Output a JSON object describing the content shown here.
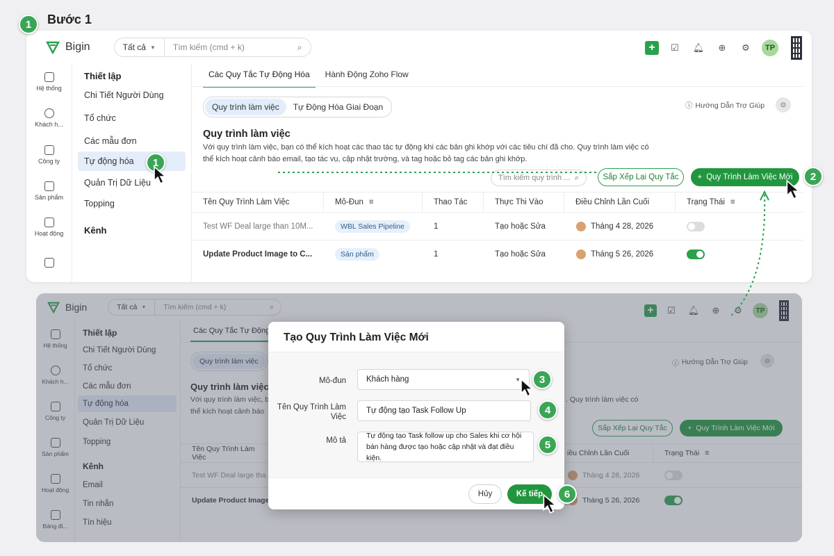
{
  "step_title": "Bước 1",
  "app_name": "Bigin",
  "search": {
    "scope": "Tất cả",
    "placeholder": "Tìm kiếm (cmd + k)"
  },
  "avatar": "TP",
  "left_nav": [
    "Hệ thống",
    "Khách h...",
    "Công ty",
    "Sản phẩm",
    "Hoạt động",
    ""
  ],
  "left_nav_back": [
    "Hệ thống",
    "Khách h...",
    "Công ty",
    "Sản phẩm",
    "Hoạt động",
    "Bảng đi..."
  ],
  "setup": {
    "heading": "Thiết lập",
    "items": [
      "Chi Tiết Người Dùng",
      "Tổ chức",
      "Các mẫu đơn",
      "Tự động hóa",
      "Quản Trị Dữ Liệu",
      "Topping"
    ],
    "channel_heading": "Kênh",
    "channel_items": [
      "Email",
      "Tin nhắn",
      "Tín hiệu"
    ]
  },
  "tabs": [
    "Các Quy Tắc Tự Động Hóa",
    "Hành Động Zoho Flow"
  ],
  "tab_back_truncated": "Các Quy Tắc Tự Động",
  "segments": [
    "Quy trình làm việc",
    "Tự Động Hóa Giai Đoạn"
  ],
  "help_link": "Hướng Dẫn Trợ Giúp",
  "section_title": "Quy trình làm việc",
  "section_title_back": "Quy trình làm việc",
  "description_line1": "Với quy trình làm việc, bạn có thể kích hoạt các thao tác tự động khi các bản ghi khớp với các tiêu chí đã cho. Quy trình làm việc có",
  "description_line2": "thể kích hoạt cảnh báo email, tạo tác vụ, cập nhật trường, và tag hoặc bỏ tag các bản ghi khớp.",
  "description_back_line1": "Với quy trình làm việc, b",
  "description_back_line2": "thể kích hoạt cảnh báo",
  "description_back_tail": ". Quy trình làm việc có",
  "table_search_placeholder": "Tìm kiếm quy trình ...",
  "reorder_button": "Sắp Xếp Lại Quy Tắc",
  "new_button": "Quy Trình Làm Việc Mới",
  "columns": [
    "Tên Quy Trình Làm Việc",
    "Mô-Đun",
    "Thao Tác",
    "Thực Thi Vào",
    "Điều Chỉnh Lần Cuối",
    "Trạng Thái"
  ],
  "column_back_last_modified": "iều Chỉnh Lần Cuối",
  "rows": [
    {
      "name": "Test WF Deal large than 10M...",
      "name_back": "Test WF Deal large tha",
      "module": "WBL Sales Pipeline",
      "actions": "1",
      "execute_on": "Tạo hoặc Sửa",
      "modified": "Tháng 4 28, 2026",
      "active": false
    },
    {
      "name": "Update Product Image to C...",
      "name_back": "Update Product Image",
      "module": "Sản phẩm",
      "actions": "1",
      "execute_on": "Tạo hoặc Sửa",
      "modified": "Tháng 5 26, 2026",
      "active": true
    }
  ],
  "modal": {
    "title": "Tạo Quy Trình Làm Việc Mới",
    "module_label": "Mô-đun",
    "module_value": "Khách hàng",
    "name_label_line1": "Tên Quy Trình Làm",
    "name_label_line2": "Việc",
    "name_value": "Tự động tạo Task Follow Up",
    "desc_label": "Mô tả",
    "desc_line1": "Tự động tạo Task follow up cho Sales khi cơ hội",
    "desc_line2": "bán hàng được tạo hoặc cập nhật và đạt điều kiện.",
    "cancel": "Hủy",
    "next": "Kế tiếp"
  },
  "badges": [
    "1",
    "1",
    "2",
    "3",
    "4",
    "5",
    "6"
  ],
  "colors": {
    "accent": "#22963f",
    "badge": "#3aa655",
    "selected": "#e4eefb"
  }
}
